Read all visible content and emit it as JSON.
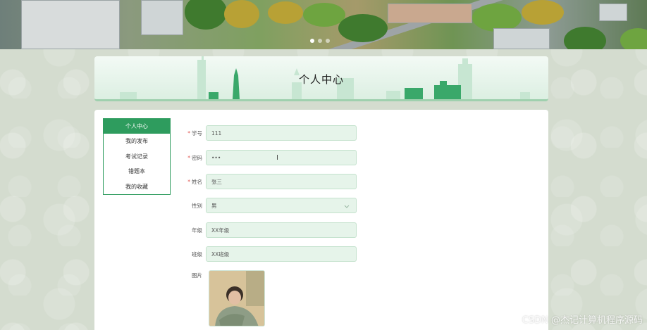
{
  "carousel": {
    "slides": [
      "",
      "",
      ""
    ],
    "active_index": 0
  },
  "header": {
    "title": "个人中心"
  },
  "sidebar": {
    "items": [
      {
        "label": "个人中心",
        "active": true
      },
      {
        "label": "我的发布",
        "active": false
      },
      {
        "label": "考试记录",
        "active": false
      },
      {
        "label": "错题本",
        "active": false
      },
      {
        "label": "我的收藏",
        "active": false
      }
    ]
  },
  "form": {
    "fields": [
      {
        "label": "学号",
        "required": true,
        "value": "111",
        "type": "text"
      },
      {
        "label": "密码",
        "required": true,
        "value": "•••",
        "type": "password"
      },
      {
        "label": "姓名",
        "required": true,
        "value": "张三",
        "type": "text"
      },
      {
        "label": "性别",
        "required": false,
        "value": "男",
        "type": "select"
      },
      {
        "label": "年级",
        "required": false,
        "value": "XX年级",
        "type": "text"
      },
      {
        "label": "班级",
        "required": false,
        "value": "XX班级",
        "type": "text"
      }
    ],
    "photo_label": "图片",
    "required_mark": "*"
  },
  "cursor_glyph": "I",
  "watermark": "CSDN @杰记计算机程序源码",
  "colors": {
    "accent": "#2e9c5e",
    "input_bg": "#e6f4ea",
    "required": "#e0534f"
  }
}
